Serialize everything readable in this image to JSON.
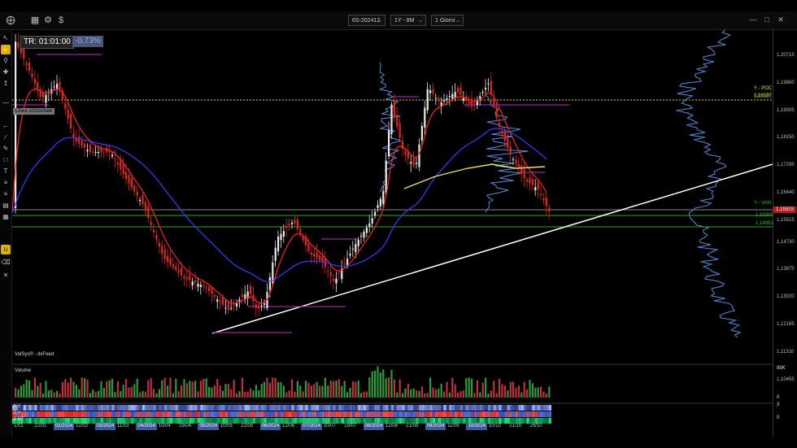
{
  "toolbar_top": {
    "symbol": "6S-202412",
    "range": "1Y - 8M",
    "interval": "1 Giorni",
    "icons": [
      "crosshair-icon",
      "bar-chart-icon",
      "gear-icon",
      "dollar-icon"
    ]
  },
  "overlay": {
    "tr_label": "TR: 01:01:00",
    "change_pct": "-0,73%",
    "tooltip": "Linea orizzontale"
  },
  "labels": {
    "poc": "Y - POC",
    "poc_price": "1,19197",
    "vah": "Y - VAH",
    "vah_price": "1,15515",
    "val_price": "1,14953",
    "mid_price": "1,15300",
    "source": "VolSys® - dxFeed",
    "volume_title": "Volume",
    "volume_max": "88K",
    "volume_zero": "0",
    "osc_max": "3",
    "osc_zero": "0",
    "pane_labels": [
      "Δ V",
      "Δ V",
      "Δ NT"
    ]
  },
  "price_axis": [
    "1,20715",
    "1,19860",
    "1,19005",
    "1,18150",
    "1,17295",
    "1,16440",
    "1,15515",
    "1,14730",
    "1,13875",
    "1,13020",
    "1,12165",
    "1,11310",
    "1,10455"
  ],
  "dates": [
    {
      "label": "1/01",
      "hl": false
    },
    {
      "label": "22/01",
      "hl": false
    },
    {
      "label": "02/2024",
      "hl": true
    },
    {
      "label": "12/02",
      "hl": false
    },
    {
      "label": "03/2024",
      "hl": true
    },
    {
      "label": "11/03",
      "hl": false
    },
    {
      "label": "04/2024",
      "hl": true
    },
    {
      "label": "10/04",
      "hl": false
    },
    {
      "label": "19/04",
      "hl": false
    },
    {
      "label": "05/2024",
      "hl": true
    },
    {
      "label": "10/05",
      "hl": false
    },
    {
      "label": "21/05",
      "hl": false
    },
    {
      "label": "06/2024",
      "hl": true
    },
    {
      "label": "12/06",
      "hl": false
    },
    {
      "label": "07/2024",
      "hl": true
    },
    {
      "label": "10/07",
      "hl": false
    },
    {
      "label": "19/07",
      "hl": false
    },
    {
      "label": "08/2024",
      "hl": true
    },
    {
      "label": "12/08",
      "hl": false
    },
    {
      "label": "21/08",
      "hl": false
    },
    {
      "label": "09/2024",
      "hl": true
    },
    {
      "label": "11/09",
      "hl": false
    },
    {
      "label": "10/2024",
      "hl": true
    },
    {
      "label": "10/10",
      "hl": false
    },
    {
      "label": "21/10",
      "hl": false
    },
    {
      "label": "29/10",
      "hl": false
    }
  ],
  "colors": {
    "up": "#e8e8e8",
    "down": "#e0251b",
    "ema_fast": "#ff2020",
    "ema_slow": "#3b3bff",
    "vwap": "#e8e060",
    "poc_line": "#d6d600",
    "support": "#1fa81f",
    "trend": "#ffffff",
    "profile": "#5a8ad6"
  }
}
